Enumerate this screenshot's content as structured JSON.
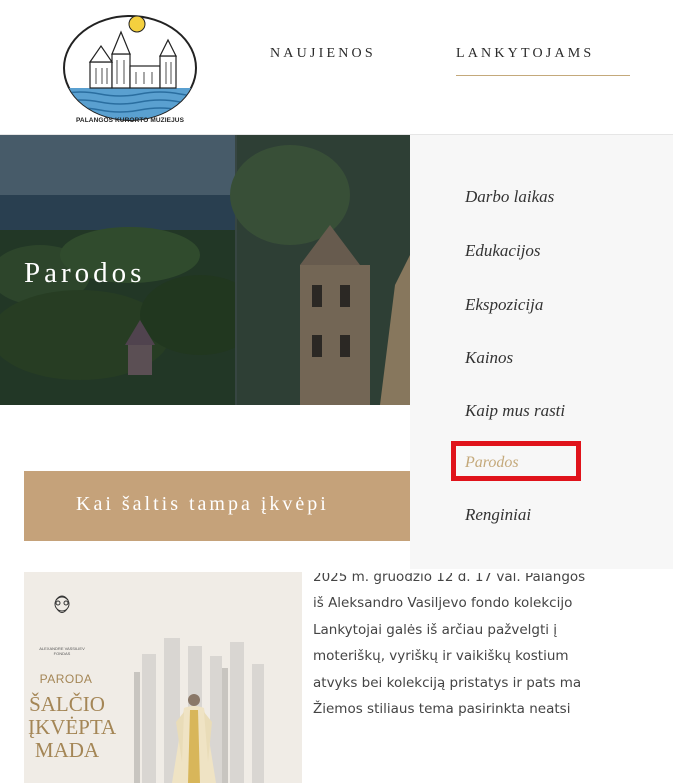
{
  "header": {
    "logo_caption": "PALANGOS KURORTO MUZIEJUS",
    "nav": [
      {
        "label": "NAUJIENOS"
      },
      {
        "label": "LANKYTOJAMS"
      }
    ]
  },
  "hero": {
    "title": "Parodos"
  },
  "dropdown": {
    "items": [
      {
        "label": "Darbo laikas"
      },
      {
        "label": "Edukacijos"
      },
      {
        "label": "Ekspozicija"
      },
      {
        "label": "Kainos"
      },
      {
        "label": "Kaip mus rasti"
      },
      {
        "label": "Parodos"
      },
      {
        "label": "Renginiai"
      }
    ]
  },
  "banner": {
    "text": "Kai šaltis tampa įkvėpi"
  },
  "poster": {
    "fund_line1": "ALEXANDRE VASSILIEV",
    "fund_line2": "FONDAS",
    "label": "PARODA",
    "line1": "ŠALČIO",
    "line2": "ĮKVĖPTA",
    "line3": "MADA"
  },
  "article": {
    "lines": [
      "2025 m. gruodžio 12 d. 17 val. Palangos",
      "iš Aleksandro Vasiljevo fondo kolekcijo",
      "Lankytojai galės iš arčiau pažvelgti į",
      "moteriškų, vyriškų ir vaikiškų kostium",
      "atvyks bei kolekciją pristatys ir pats ma",
      "Žiemos stiliaus tema pasirinkta neatsi"
    ]
  },
  "colors": {
    "accent": "#c4a97b",
    "banner": "#c5a27a",
    "highlight": "#e0131b"
  }
}
